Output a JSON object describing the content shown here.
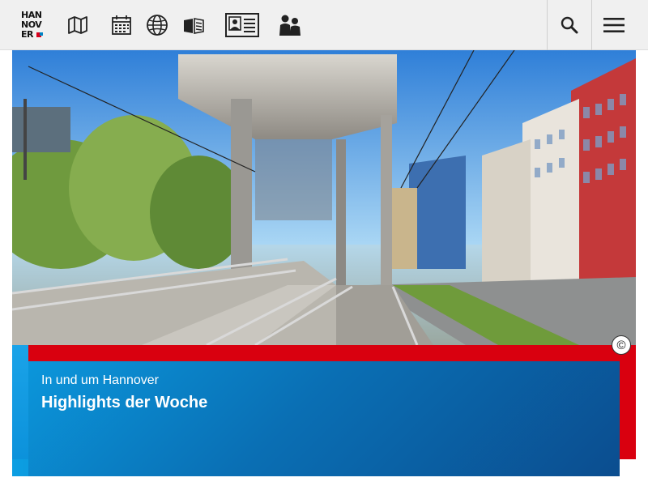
{
  "header": {
    "logo_lines": [
      "HAN",
      "NOV",
      "ER"
    ],
    "nav_icons": [
      "map-icon",
      "calendar-icon",
      "globe-icon",
      "reading-book-icon",
      "id-card-icon",
      "people-icon"
    ],
    "search_icon": "search-icon",
    "menu_icon": "hamburger-menu-icon"
  },
  "hero": {
    "copyright_symbol": "©"
  },
  "teaser": {
    "subtitle": "In und um Hannover",
    "title": "Highlights der Woche"
  },
  "colors": {
    "accent_red": "#d9000f",
    "teaser_blue_start": "#0b96db",
    "teaser_blue_end": "#0b4d8f",
    "header_bg": "#f0f0f0"
  }
}
